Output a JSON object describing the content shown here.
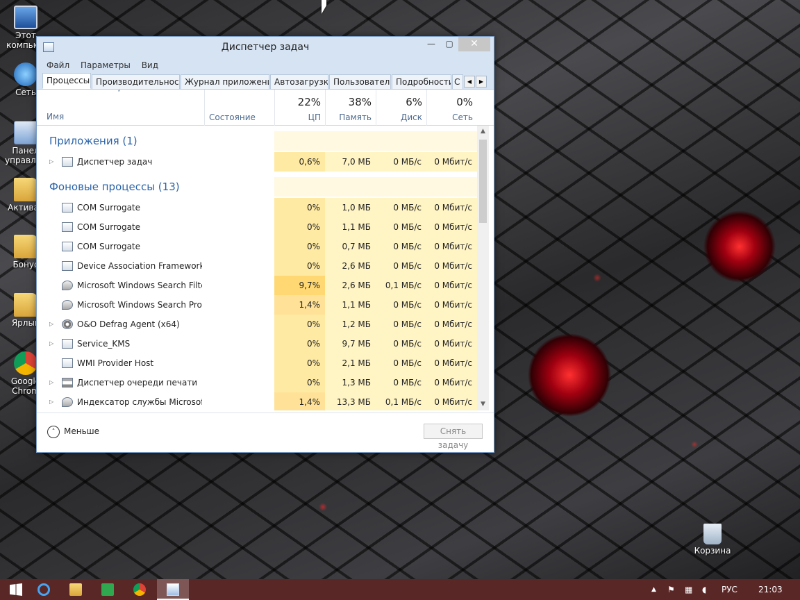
{
  "desktop": {
    "icons": [
      {
        "label": "Этот компьют",
        "icon": "computer-icon"
      },
      {
        "label": "Сеть",
        "icon": "network-icon"
      },
      {
        "label": "Панел управлен",
        "icon": "control-panel-icon"
      },
      {
        "label": "Активат",
        "icon": "folder-icon"
      },
      {
        "label": "Бонус",
        "icon": "folder-icon"
      },
      {
        "label": "Ярлык",
        "icon": "folder-icon"
      },
      {
        "label": "Google Chrom",
        "icon": "chrome-icon"
      }
    ],
    "recycle_bin": "Корзина"
  },
  "window": {
    "title": "Диспетчер задач",
    "close_glyph": "✕",
    "menu": [
      "Файл",
      "Параметры",
      "Вид"
    ],
    "tabs": [
      "Процессы",
      "Производительность",
      "Журнал приложений",
      "Автозагрузка",
      "Пользователи",
      "Подробности",
      "С"
    ],
    "tab_prev": "◀",
    "tab_next": "▶"
  },
  "columns": {
    "name": "Имя",
    "state": "Состояние",
    "sort_glyph": "˄",
    "cpu": {
      "pct": "22%",
      "label": "ЦП"
    },
    "memory": {
      "pct": "38%",
      "label": "Память"
    },
    "disk": {
      "pct": "6%",
      "label": "Диск"
    },
    "network": {
      "pct": "0%",
      "label": "Сеть"
    }
  },
  "groups": {
    "apps": "Приложения (1)",
    "background": "Фоновые процессы (13)"
  },
  "apps": [
    {
      "name": "Диспетчер задач",
      "cpu": "0,6%",
      "mem": "7,0 МБ",
      "disk": "0 МБ/с",
      "net": "0 Мбит/с"
    }
  ],
  "background": [
    {
      "name": "COM Surrogate",
      "cpu": "0%",
      "mem": "1,0 МБ",
      "disk": "0 МБ/с",
      "net": "0 Мбит/с"
    },
    {
      "name": "COM Surrogate",
      "cpu": "0%",
      "mem": "1,1 МБ",
      "disk": "0 МБ/с",
      "net": "0 Мбит/с"
    },
    {
      "name": "COM Surrogate",
      "cpu": "0%",
      "mem": "0,7 МБ",
      "disk": "0 МБ/с",
      "net": "0 Мбит/с"
    },
    {
      "name": "Device Association Framework ...",
      "cpu": "0%",
      "mem": "2,6 МБ",
      "disk": "0 МБ/с",
      "net": "0 Мбит/с"
    },
    {
      "name": "Microsoft Windows Search Filte...",
      "cpu": "9,7%",
      "mem": "2,6 МБ",
      "disk": "0,1 МБ/с",
      "net": "0 Мбит/с"
    },
    {
      "name": "Microsoft Windows Search Prot...",
      "cpu": "1,4%",
      "mem": "1,1 МБ",
      "disk": "0 МБ/с",
      "net": "0 Мбит/с"
    },
    {
      "name": "O&O Defrag Agent (x64)",
      "cpu": "0%",
      "mem": "1,2 МБ",
      "disk": "0 МБ/с",
      "net": "0 Мбит/с"
    },
    {
      "name": "Service_KMS",
      "cpu": "0%",
      "mem": "9,7 МБ",
      "disk": "0 МБ/с",
      "net": "0 Мбит/с"
    },
    {
      "name": "WMI Provider Host",
      "cpu": "0%",
      "mem": "2,1 МБ",
      "disk": "0 МБ/с",
      "net": "0 Мбит/с"
    },
    {
      "name": "Диспетчер очереди печати",
      "cpu": "0%",
      "mem": "1,3 МБ",
      "disk": "0 МБ/с",
      "net": "0 Мбит/с"
    },
    {
      "name": "Индексатор службы Microsoft ...",
      "cpu": "1,4%",
      "mem": "13,3 МБ",
      "disk": "0,1 МБ/с",
      "net": "0 Мбит/с"
    }
  ],
  "footer": {
    "less_label": "Меньше",
    "less_glyph": "˄",
    "end_task": "Снять задачу"
  },
  "taskbar": {
    "lang": "РУС",
    "time": "21:03",
    "tray_up": "▲"
  },
  "colors": {
    "accent": "#2a63a8",
    "cpu_hot": "#ffd873",
    "taskbar": "#5a2727"
  }
}
